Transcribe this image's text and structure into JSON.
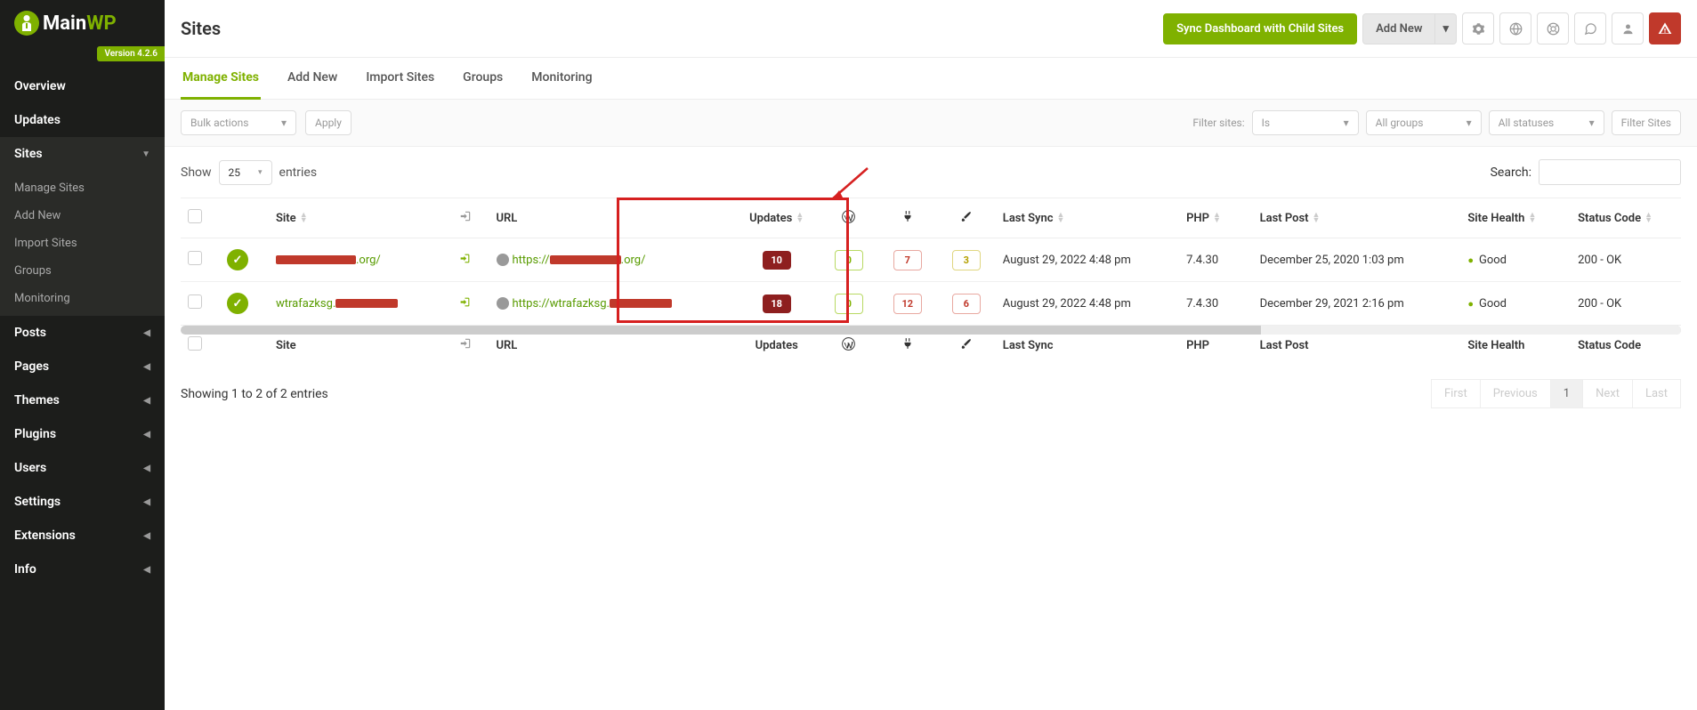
{
  "brand": {
    "name_main": "Main",
    "name_wp": "WP",
    "version": "Version 4.2.6"
  },
  "sidebar": {
    "items": [
      {
        "label": "Overview",
        "caret": false
      },
      {
        "label": "Updates",
        "caret": false
      },
      {
        "label": "Sites",
        "caret": true,
        "open": true,
        "children": [
          {
            "label": "Manage Sites"
          },
          {
            "label": "Add New"
          },
          {
            "label": "Import Sites"
          },
          {
            "label": "Groups"
          },
          {
            "label": "Monitoring"
          }
        ]
      },
      {
        "label": "Posts",
        "caret": true
      },
      {
        "label": "Pages",
        "caret": true
      },
      {
        "label": "Themes",
        "caret": true
      },
      {
        "label": "Plugins",
        "caret": true
      },
      {
        "label": "Users",
        "caret": true
      },
      {
        "label": "Settings",
        "caret": true
      },
      {
        "label": "Extensions",
        "caret": true
      },
      {
        "label": "Info",
        "caret": true
      }
    ]
  },
  "header": {
    "title": "Sites",
    "sync_label": "Sync Dashboard with Child Sites",
    "add_new_label": "Add New"
  },
  "tabs": [
    {
      "label": "Manage Sites",
      "active": true
    },
    {
      "label": "Add New"
    },
    {
      "label": "Import Sites"
    },
    {
      "label": "Groups"
    },
    {
      "label": "Monitoring"
    }
  ],
  "filters": {
    "bulk_label": "Bulk actions",
    "apply_label": "Apply",
    "filter_sites_label": "Filter sites:",
    "is_label": "Is",
    "groups_label": "All groups",
    "statuses_label": "All statuses",
    "filter_btn": "Filter Sites"
  },
  "table_ctrl": {
    "show_label": "Show",
    "entries_label": "entries",
    "page_size": "25",
    "search_label": "Search:"
  },
  "columns": {
    "site": "Site",
    "url": "URL",
    "updates": "Updates",
    "last_sync": "Last Sync",
    "php": "PHP",
    "last_post": "Last Post",
    "site_health": "Site Health",
    "status_code": "Status Code"
  },
  "rows": [
    {
      "site_suffix": ".org/",
      "url_prefix": "https://",
      "url_suffix": ".org/",
      "updates": "10",
      "wp": "0",
      "plugins": "7",
      "themes": "3",
      "last_sync": "August 29, 2022 4:48 pm",
      "php": "7.4.30",
      "last_post": "December 25, 2020 1:03 pm",
      "health": "Good",
      "status_code": "200 - OK"
    },
    {
      "site_prefix": "wtrafazksg.",
      "url_prefix": "https://wtrafazksg.",
      "url_suffix": "",
      "updates": "18",
      "wp": "0",
      "plugins": "12",
      "themes": "6",
      "last_sync": "August 29, 2022 4:48 pm",
      "php": "7.4.30",
      "last_post": "December 29, 2021 2:16 pm",
      "health": "Good",
      "status_code": "200 - OK"
    }
  ],
  "footer": {
    "info": "Showing 1 to 2 of 2 entries",
    "first": "First",
    "prev": "Previous",
    "page": "1",
    "next": "Next",
    "last": "Last"
  }
}
